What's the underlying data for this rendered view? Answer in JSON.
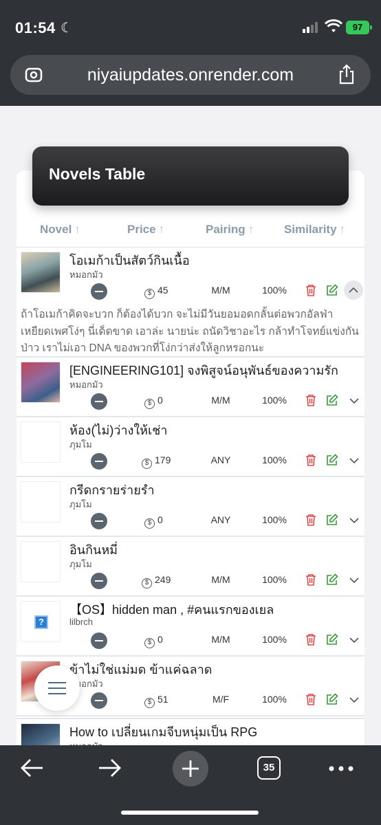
{
  "status_bar": {
    "time": "01:54",
    "battery": "97"
  },
  "browser": {
    "url": "niyaiupdates.onrender.com",
    "tab_count": "35"
  },
  "card": {
    "title": "Novels Table"
  },
  "table": {
    "columns": [
      "Novel",
      "Price",
      "Pairing",
      "Similarity"
    ],
    "rows": [
      {
        "title": "โอเมก้าเป็นสัตว์กินเนื้อ",
        "author": "หมอกมัว",
        "price": "45",
        "pairing": "M/M",
        "similarity": "100%",
        "description": "ถ้าโอเมก้าคิดจะบวก ก็ต้องได้บวก จะไม่มีวันยอมอดกลั้นต่อพวกอัลฟ่าเหยียดเพศโง่ๆ นี่เด็ดขาด เอาล่ะ นายน่ะ ถนัดวิชาอะไร กล้าทำโจทย์แข่งกันป่าว เราไม่เอา DNA ของพวกที่โง่กว่าส่งให้ลูกหรอกนะ"
      },
      {
        "title": "[ENGINEERING101] จงพิสูจน์อนุพันธ์ของความรัก",
        "author": "หมอกมัว",
        "price": "0",
        "pairing": "M/M",
        "similarity": "100%"
      },
      {
        "title": "ห้อง(ไม่)ว่างให้เช่า",
        "author": "ภุมโม",
        "price": "179",
        "pairing": "ANY",
        "similarity": "100%"
      },
      {
        "title": "กรีดกรายร่ายรำ",
        "author": "ภุมโม",
        "price": "0",
        "pairing": "ANY",
        "similarity": "100%"
      },
      {
        "title": "อินกินหมี่",
        "author": "ภุมโม",
        "price": "249",
        "pairing": "M/M",
        "similarity": "100%"
      },
      {
        "title": "【OS】hidden man , #คนแรกของเยล",
        "author": "lilbrch",
        "price": "0",
        "pairing": "M/M",
        "similarity": "100%"
      },
      {
        "title": "ข้าไม่ใช่แม่มด ข้าแค่ฉลาด",
        "author": "หมอกมัว",
        "price": "51",
        "pairing": "M/F",
        "similarity": "100%"
      },
      {
        "title": "How to เปลี่ยนเกมจีบหนุ่มเป็น RPG",
        "author": "หมอกมัว"
      }
    ]
  },
  "colors": {
    "accent_header": "#1c1c1e",
    "trash": "#e04848",
    "edit": "#3a9a3a",
    "column_header": "#8a9bab"
  }
}
